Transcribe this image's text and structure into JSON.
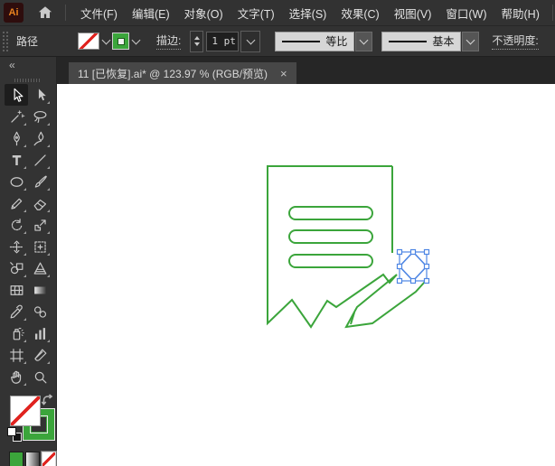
{
  "menu_bar": {
    "logo": "Ai",
    "items": [
      "文件(F)",
      "编辑(E)",
      "对象(O)",
      "文字(T)",
      "选择(S)",
      "效果(C)",
      "视图(V)",
      "窗口(W)",
      "帮助(H)"
    ]
  },
  "control_bar": {
    "selection_label": "路径",
    "stroke_label": "描边:",
    "stroke_weight": "1 pt",
    "width_profile_label": "等比",
    "brush_definition_label": "基本",
    "opacity_label": "不透明度:"
  },
  "document_tab": {
    "title": "11 [已恢复].ai* @ 123.97 % (RGB/预览)",
    "close_icon": "×"
  },
  "tools_panel": {
    "collapse_icon": "«",
    "tools": [
      {
        "name": "selection",
        "selected": true,
        "flyout": false
      },
      {
        "name": "direct-selection",
        "selected": false,
        "flyout": true
      },
      {
        "name": "magic-wand",
        "selected": false,
        "flyout": true
      },
      {
        "name": "lasso",
        "selected": false,
        "flyout": true
      },
      {
        "name": "pen",
        "selected": false,
        "flyout": true
      },
      {
        "name": "curvature",
        "selected": false,
        "flyout": true
      },
      {
        "name": "type",
        "selected": false,
        "flyout": true
      },
      {
        "name": "line-segment",
        "selected": false,
        "flyout": true
      },
      {
        "name": "ellipse",
        "selected": false,
        "flyout": true
      },
      {
        "name": "paintbrush",
        "selected": false,
        "flyout": true
      },
      {
        "name": "shaper",
        "selected": false,
        "flyout": true
      },
      {
        "name": "eraser",
        "selected": false,
        "flyout": true
      },
      {
        "name": "rotate",
        "selected": false,
        "flyout": true
      },
      {
        "name": "scale",
        "selected": false,
        "flyout": true
      },
      {
        "name": "width",
        "selected": false,
        "flyout": true
      },
      {
        "name": "free-transform",
        "selected": false,
        "flyout": true
      },
      {
        "name": "shape-builder",
        "selected": false,
        "flyout": true
      },
      {
        "name": "perspective-grid",
        "selected": false,
        "flyout": true
      },
      {
        "name": "mesh",
        "selected": false,
        "flyout": false
      },
      {
        "name": "gradient",
        "selected": false,
        "flyout": false
      },
      {
        "name": "eyedropper",
        "selected": false,
        "flyout": true
      },
      {
        "name": "blend",
        "selected": false,
        "flyout": false
      },
      {
        "name": "symbol-sprayer",
        "selected": false,
        "flyout": true
      },
      {
        "name": "column-graph",
        "selected": false,
        "flyout": true
      },
      {
        "name": "artboard",
        "selected": false,
        "flyout": true
      },
      {
        "name": "slice",
        "selected": false,
        "flyout": true
      },
      {
        "name": "hand",
        "selected": false,
        "flyout": true
      },
      {
        "name": "zoom",
        "selected": false,
        "flyout": false
      }
    ]
  },
  "swatches": {
    "fill": "none",
    "stroke_color": "#3BA53B",
    "modes": [
      "color",
      "gradient",
      "none"
    ],
    "active_mode": "none"
  },
  "colors": {
    "artwork_green": "#3BA53B",
    "selection_blue": "#4E86E4",
    "swatch_red": "#E02420",
    "logo_orange": "#E8821E"
  }
}
